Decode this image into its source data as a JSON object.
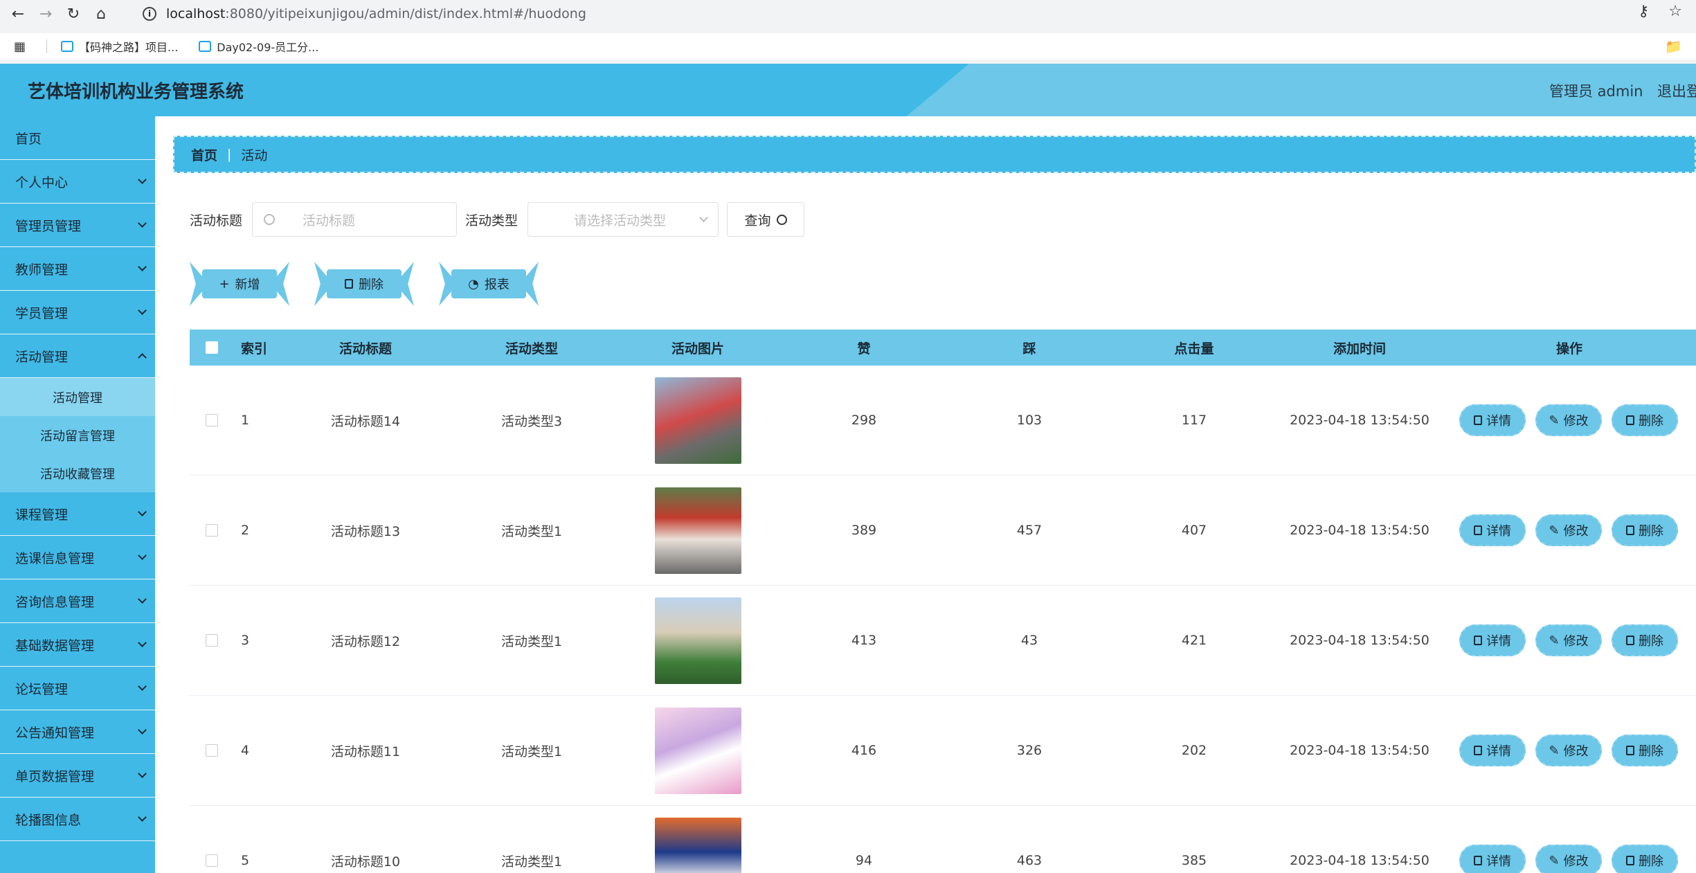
{
  "browser": {
    "url_host": "localhost",
    "url_rest": ":8080/yitipeixunjigou/admin/dist/index.html#/huodong",
    "bookmarks": [
      "【码神之路】项目...",
      "Day02-09-员工分..."
    ]
  },
  "header": {
    "title": "艺体培训机构业务管理系统",
    "user": "管理员 admin",
    "logout": "退出登录"
  },
  "sidebar": {
    "items": [
      {
        "label": "首页"
      },
      {
        "label": "个人中心"
      },
      {
        "label": "管理员管理"
      },
      {
        "label": "教师管理"
      },
      {
        "label": "学员管理"
      },
      {
        "label": "活动管理"
      }
    ],
    "subitems": [
      "活动管理",
      "活动留言管理",
      "活动收藏管理"
    ],
    "items_after": [
      {
        "label": "课程管理"
      },
      {
        "label": "选课信息管理"
      },
      {
        "label": "咨询信息管理"
      },
      {
        "label": "基础数据管理"
      },
      {
        "label": "论坛管理"
      },
      {
        "label": "公告通知管理"
      },
      {
        "label": "单页数据管理"
      },
      {
        "label": "轮播图信息"
      }
    ]
  },
  "breadcrumb": {
    "home": "首页",
    "current": "活动"
  },
  "search": {
    "title_label": "活动标题",
    "title_placeholder": "活动标题",
    "type_label": "活动类型",
    "type_placeholder": "请选择活动类型",
    "query": "查询"
  },
  "actions": {
    "add": "新增",
    "delete": "删除",
    "report": "报表"
  },
  "table": {
    "headers": [
      "索引",
      "活动标题",
      "活动类型",
      "活动图片",
      "赞",
      "踩",
      "点击量",
      "添加时间",
      "操作"
    ],
    "ops": [
      "详情",
      "修改",
      "删除"
    ],
    "rows": [
      {
        "idx": "1",
        "title": "活动标题14",
        "type": "活动类型3",
        "zan": "298",
        "cai": "103",
        "click": "117",
        "time": "2023-04-18 13:54:50"
      },
      {
        "idx": "2",
        "title": "活动标题13",
        "type": "活动类型1",
        "zan": "389",
        "cai": "457",
        "click": "407",
        "time": "2023-04-18 13:54:50"
      },
      {
        "idx": "3",
        "title": "活动标题12",
        "type": "活动类型1",
        "zan": "413",
        "cai": "43",
        "click": "421",
        "time": "2023-04-18 13:54:50"
      },
      {
        "idx": "4",
        "title": "活动标题11",
        "type": "活动类型1",
        "zan": "416",
        "cai": "326",
        "click": "202",
        "time": "2023-04-18 13:54:50"
      },
      {
        "idx": "5",
        "title": "活动标题10",
        "type": "活动类型1",
        "zan": "94",
        "cai": "463",
        "click": "385",
        "time": "2023-04-18 13:54:50"
      }
    ]
  },
  "colors": {
    "primary": "#41b9e6",
    "light": "#6cc7e8"
  }
}
